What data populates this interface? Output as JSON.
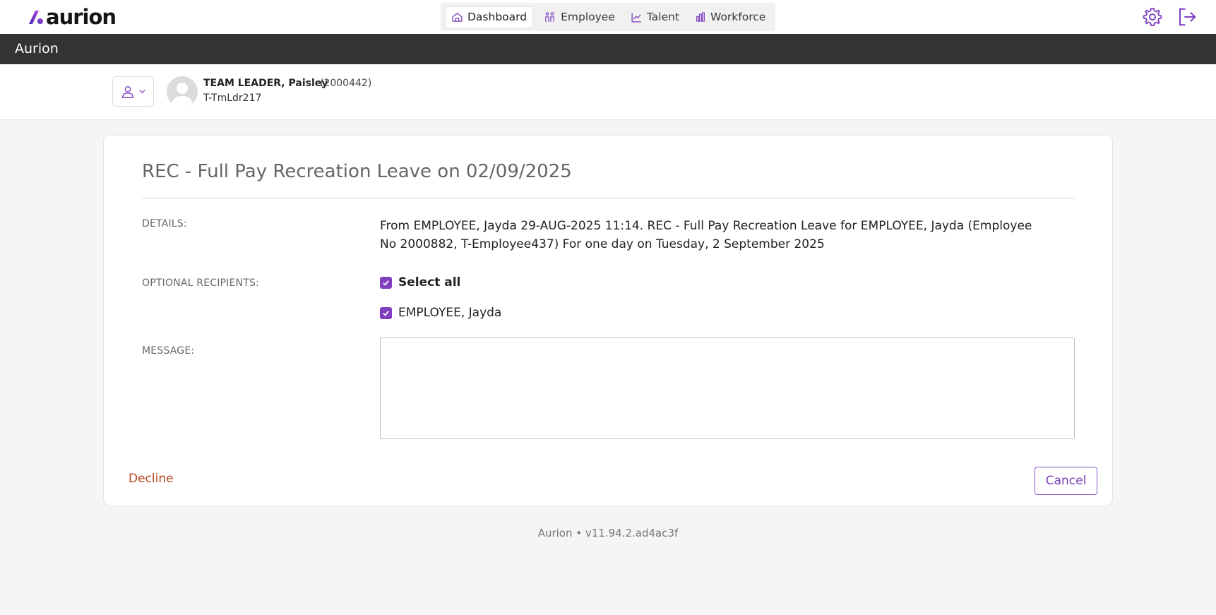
{
  "brand": {
    "logo_text": "aurion",
    "accent_color": "#7f3fbf",
    "logo_gradient": [
      "#4b2bb8",
      "#b04ad8"
    ]
  },
  "nav": {
    "tabs": [
      {
        "label": "Dashboard",
        "icon": "home-icon",
        "active": true
      },
      {
        "label": "Employee",
        "icon": "people-icon",
        "active": false
      },
      {
        "label": "Talent",
        "icon": "trend-chart-icon",
        "active": false
      },
      {
        "label": "Workforce",
        "icon": "bar-chart-icon",
        "active": false
      }
    ]
  },
  "header_icons": {
    "settings": "gear-icon",
    "logout": "logout-icon"
  },
  "titlebar": {
    "title": "Aurion"
  },
  "user": {
    "name": "TEAM LEADER, Paisley",
    "id": "(2000442)",
    "code": "T-TmLdr217"
  },
  "form": {
    "title": "REC - Full Pay Recreation Leave on 02/09/2025",
    "details_label": "DETAILS:",
    "details_text": "From EMPLOYEE, Jayda 29-AUG-2025 11:14. REC - Full Pay Recreation Leave for EMPLOYEE, Jayda (Employee No 2000882, T-Employee437) For one day on Tuesday, 2 September 2025",
    "recipients_label": "OPTIONAL RECIPIENTS:",
    "select_all_label": "Select all",
    "select_all_checked": true,
    "recipients": [
      {
        "label": "EMPLOYEE, Jayda",
        "checked": true
      }
    ],
    "message_label": "MESSAGE:",
    "message_value": "",
    "decline_label": "Decline",
    "cancel_label": "Cancel"
  },
  "footer": {
    "version_text": "Aurion • v11.94.2.ad4ac3f"
  }
}
